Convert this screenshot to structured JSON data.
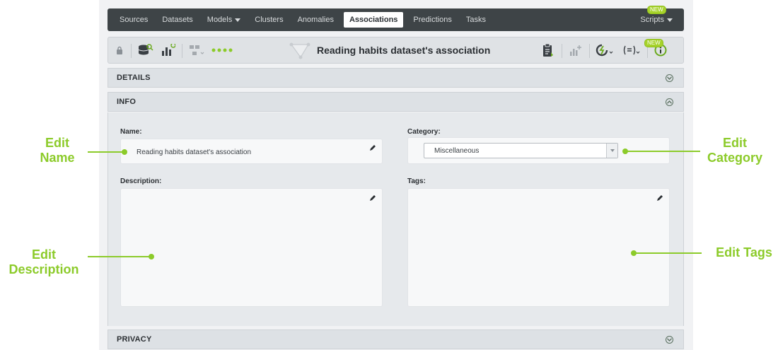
{
  "nav": {
    "items": [
      {
        "label": "Sources",
        "active": false,
        "caret": false
      },
      {
        "label": "Datasets",
        "active": false,
        "caret": false
      },
      {
        "label": "Models",
        "active": false,
        "caret": true
      },
      {
        "label": "Clusters",
        "active": false,
        "caret": false
      },
      {
        "label": "Anomalies",
        "active": false,
        "caret": false
      },
      {
        "label": "Associations",
        "active": true,
        "caret": false
      },
      {
        "label": "Predictions",
        "active": false,
        "caret": false
      },
      {
        "label": "Tasks",
        "active": false,
        "caret": false
      }
    ],
    "scripts_label": "Scripts",
    "scripts_badge": "NEW"
  },
  "toolbar": {
    "title": "Reading habits dataset's association",
    "icons": {
      "left": [
        "lock-icon",
        "dataset-icon",
        "chart-icon",
        "model-icon",
        "more-dots-icon"
      ],
      "title_icon": "association-icon",
      "right": [
        "report-icon",
        "add-chart-icon",
        "batch-icon",
        "formula-icon",
        "info-icon"
      ]
    },
    "formula_badge": "NEW"
  },
  "panels": {
    "details": {
      "title": "DETAILS",
      "expanded": false
    },
    "info": {
      "title": "INFO",
      "expanded": true
    },
    "privacy": {
      "title": "PRIVACY",
      "expanded": false
    }
  },
  "info": {
    "name_label": "Name:",
    "name_value": "Reading habits dataset's association",
    "category_label": "Category:",
    "category_value": "Miscellaneous",
    "description_label": "Description:",
    "description_value": "",
    "tags_label": "Tags:",
    "tags_value": ""
  },
  "annotations": {
    "edit_name": "Edit\nName",
    "edit_description": "Edit\nDescription",
    "edit_category": "Edit\nCategory",
    "edit_tags": "Edit Tags"
  },
  "colors": {
    "accent": "#8ccb2a",
    "nav_bg": "#3e4447",
    "new_badge": "#a6d22a",
    "info_icon": "#6aaa1e"
  }
}
